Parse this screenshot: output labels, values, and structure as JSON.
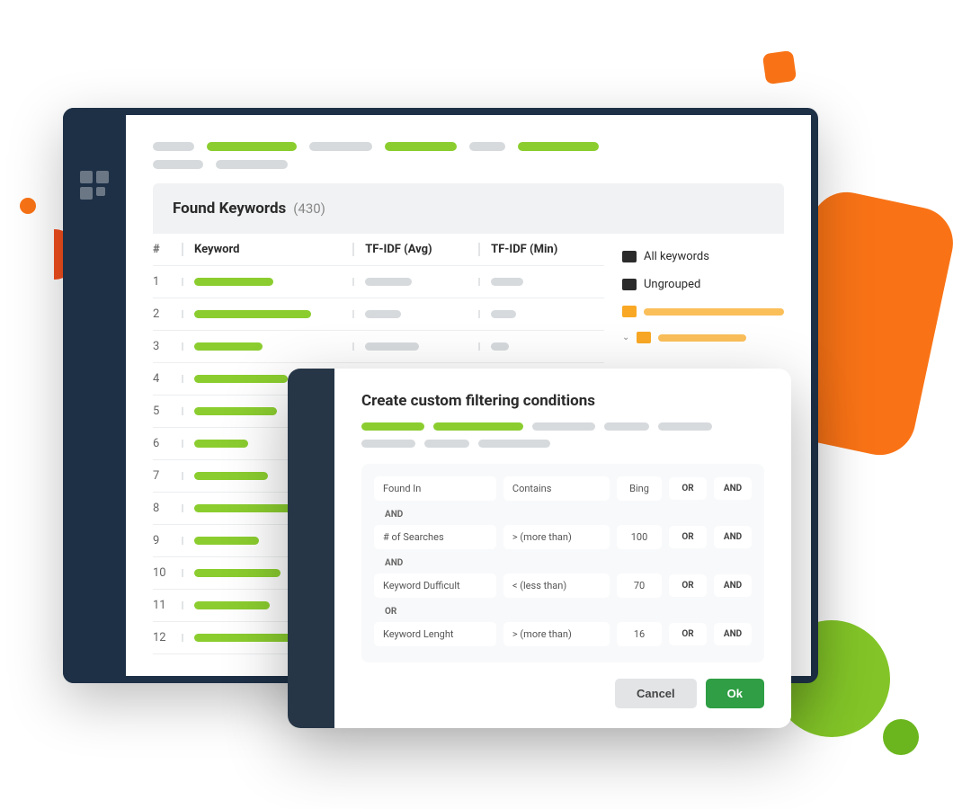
{
  "header": {
    "title": "Found Keywords",
    "count": "(430)"
  },
  "columns": {
    "num": "#",
    "keyword": "Keyword",
    "tfidf_avg": "TF-IDF (Avg)",
    "tfidf_min": "TF-IDF (Min)"
  },
  "rows": [
    {
      "n": "1",
      "kw_w": 88,
      "a_w": 52,
      "m_w": 36
    },
    {
      "n": "2",
      "kw_w": 130,
      "a_w": 40,
      "m_w": 28
    },
    {
      "n": "3",
      "kw_w": 76,
      "a_w": 60,
      "m_w": 20
    },
    {
      "n": "4",
      "kw_w": 104,
      "a_w": 0,
      "m_w": 0
    },
    {
      "n": "5",
      "kw_w": 92,
      "a_w": 0,
      "m_w": 0
    },
    {
      "n": "6",
      "kw_w": 60,
      "a_w": 0,
      "m_w": 0
    },
    {
      "n": "7",
      "kw_w": 82,
      "a_w": 0,
      "m_w": 0
    },
    {
      "n": "8",
      "kw_w": 116,
      "a_w": 0,
      "m_w": 0
    },
    {
      "n": "9",
      "kw_w": 72,
      "a_w": 0,
      "m_w": 0
    },
    {
      "n": "10",
      "kw_w": 96,
      "a_w": 0,
      "m_w": 0
    },
    {
      "n": "11",
      "kw_w": 84,
      "a_w": 0,
      "m_w": 0
    },
    {
      "n": "12",
      "kw_w": 108,
      "a_w": 0,
      "m_w": 0
    }
  ],
  "groups": {
    "all": "All keywords",
    "ungrouped": "Ungrouped"
  },
  "modal": {
    "title": "Create custom filtering conditions",
    "conditions": [
      {
        "field": "Found In",
        "op": "Contains",
        "val": "Bing",
        "l1": "OR",
        "l2": "AND",
        "conn_after": "AND"
      },
      {
        "field": "# of Searches",
        "op": "> (more than)",
        "val": "100",
        "l1": "OR",
        "l2": "AND",
        "conn_after": "AND"
      },
      {
        "field": "Keyword Dufficult",
        "op": "< (less than)",
        "val": "70",
        "l1": "OR",
        "l2": "AND",
        "conn_after": "OR"
      },
      {
        "field": "Keyword Lenght",
        "op": "> (more than)",
        "val": "16",
        "l1": "OR",
        "l2": "AND",
        "conn_after": ""
      }
    ],
    "cancel": "Cancel",
    "ok": "Ok"
  }
}
